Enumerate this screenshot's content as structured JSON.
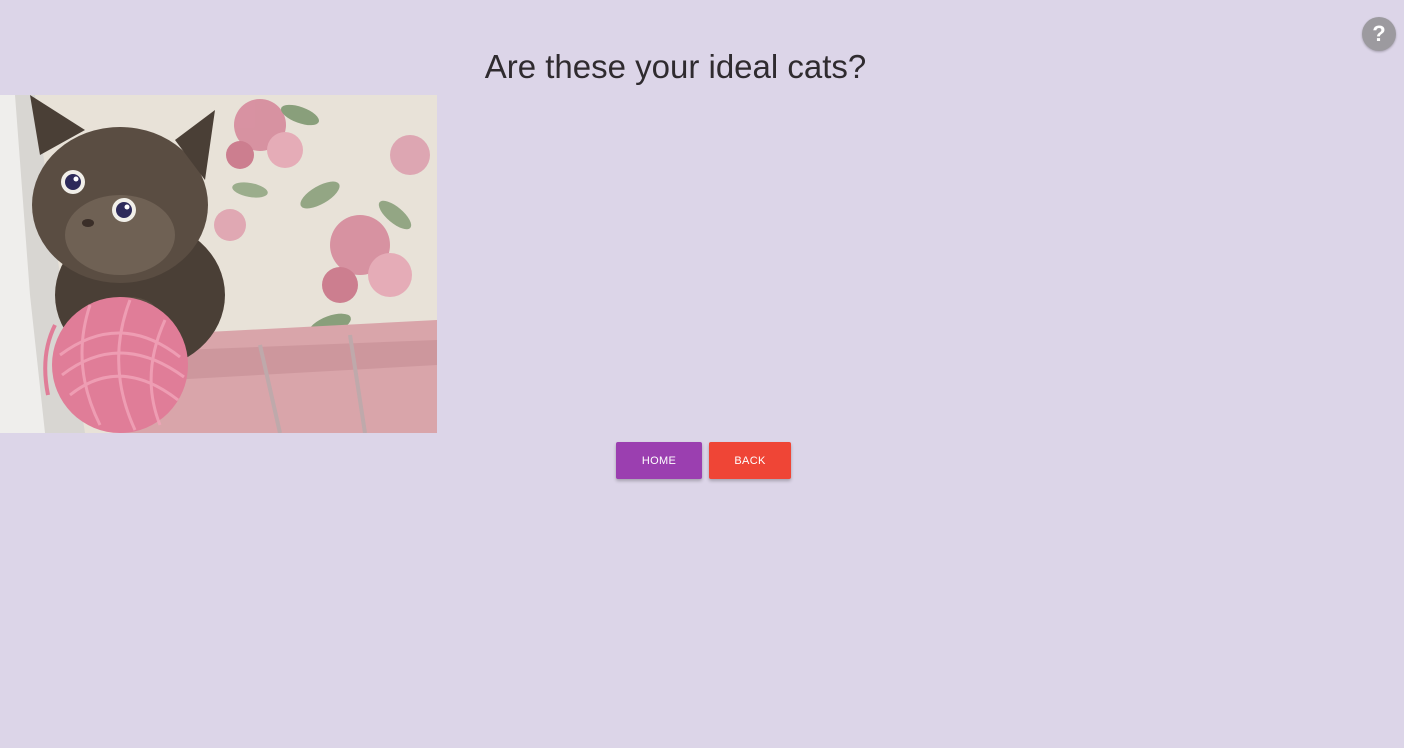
{
  "help": {
    "label": "?"
  },
  "page": {
    "title": "Are these your ideal cats?"
  },
  "actions": {
    "home_label": "HOME",
    "back_label": "BACK"
  },
  "colors": {
    "background": "#dcd5e8",
    "title_text": "#2f2b2f",
    "home_button": "#9b3fb0",
    "back_button": "#ef4536",
    "help_button": "#9c9a9f"
  }
}
